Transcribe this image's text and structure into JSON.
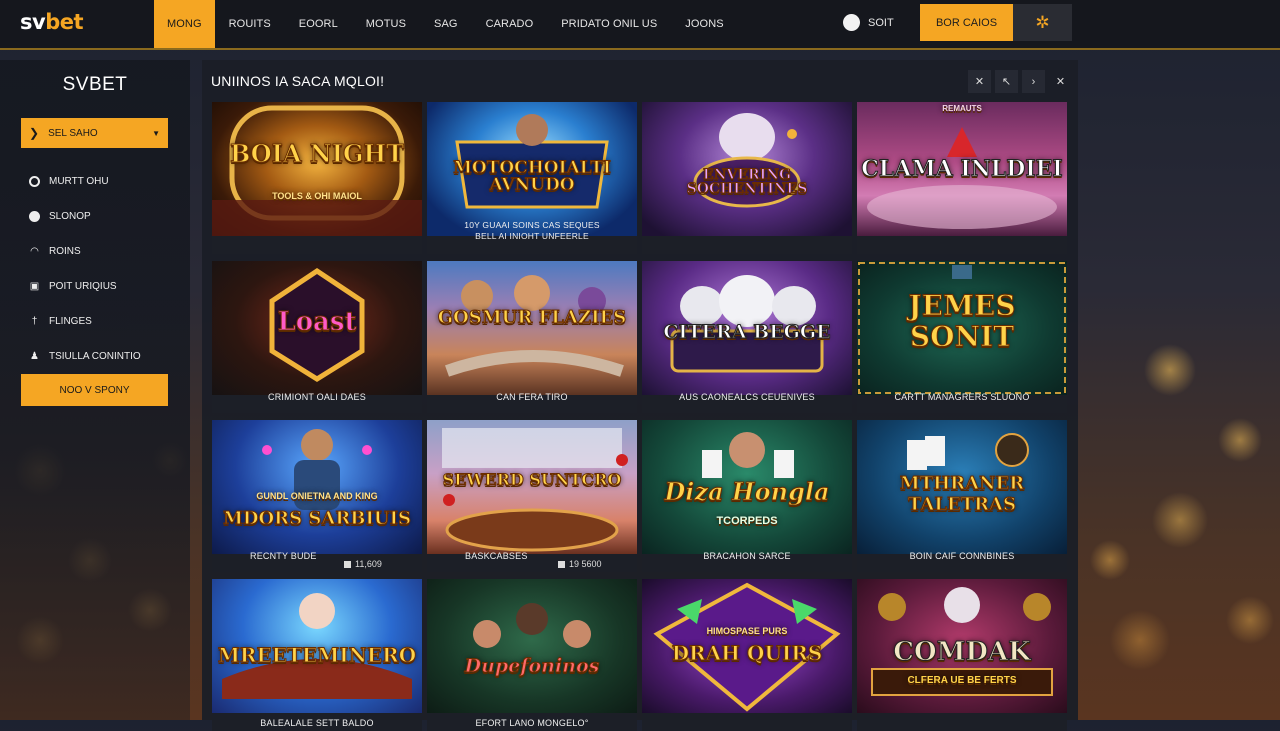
{
  "brand": {
    "logo_part1": "sv",
    "logo_part2": "bet"
  },
  "nav": {
    "items": [
      {
        "label": "MONG",
        "active": true
      },
      {
        "label": "ROUITS"
      },
      {
        "label": "EOORL"
      },
      {
        "label": "MOTUS"
      },
      {
        "label": "SAG"
      },
      {
        "label": "CARADO"
      },
      {
        "label": "PRIDATO ONIL US"
      },
      {
        "label": "JOONS"
      }
    ],
    "sort_label": "SOIT",
    "cta_label": "BOR CAIOS",
    "star_icon": "star-icon"
  },
  "sidebar": {
    "title": "SVBET",
    "select_label": "SEL SAHO",
    "items": [
      {
        "label": "MURTT OHU",
        "icon": "chat-icon"
      },
      {
        "label": "SLONOP",
        "icon": "circle-icon"
      },
      {
        "label": "ROINS",
        "icon": "signal-icon"
      },
      {
        "label": "POIT URIQIUS",
        "icon": "bag-icon"
      },
      {
        "label": "FLINGES",
        "icon": "dagger-icon"
      },
      {
        "label": "TSIULLA CONINTIO",
        "icon": "group-icon"
      }
    ],
    "cta_label": "NOO V SPONY"
  },
  "panel": {
    "title": "UNIINOS IA SACA MQLOI!",
    "controls": [
      "close-icon",
      "edit-icon",
      "next-icon",
      "dismiss-icon"
    ]
  },
  "games": [
    {
      "title": "BOIA NIGHT",
      "subtitle": "TOOLS & OHI MAIOL",
      "caption": "",
      "caption2": ""
    },
    {
      "title": "MOTOCHOIALTI AVNUDO",
      "subtitle": "",
      "caption": "10Y GUAAI SOINS CAS SEQUES",
      "caption2": "BELL AI INIOHT UNFEERLE"
    },
    {
      "title": "ENVERING SOCHENTINES",
      "subtitle": "",
      "caption": "",
      "caption2": ""
    },
    {
      "title": "CLAMA INLDIEI",
      "subtitle": "REMAUTS",
      "caption": "",
      "caption2": ""
    },
    {
      "title": "Loast",
      "subtitle": "",
      "caption": "CRIMIONT OALI DAES",
      "caption2": ""
    },
    {
      "title": "GOSMUR FLAZIES",
      "subtitle": "",
      "caption": "CAN FERA TIRO",
      "caption2": ""
    },
    {
      "title": "CITERA BEGGE",
      "subtitle": "",
      "caption": "AUS CAONEALCS CEUENIVES",
      "caption2": ""
    },
    {
      "title": "JEMES SONIT",
      "subtitle": "",
      "caption": "CARTT MANAGRERS SLUONO",
      "caption2": ""
    },
    {
      "title": "MDORS SARBIUIS",
      "subtitle": "GUNDL ONIETNA AND KING",
      "caption": "RECNTY BUDE",
      "caption2": "",
      "price": "11,609"
    },
    {
      "title": "SEWERD SUNTCRO",
      "subtitle": "",
      "caption": "BASKCABSES",
      "caption2": "",
      "price": "19 5600"
    },
    {
      "title": "Diza Hongla",
      "subtitle": "TCORPEDS",
      "caption": "BRACAHON SARCE",
      "caption2": ""
    },
    {
      "title": "MTHRANER TALETRAS",
      "subtitle": "",
      "caption": "BOIN CAIF CONNBINES",
      "caption2": ""
    },
    {
      "title": "MREETEMINERO",
      "subtitle": "",
      "caption": "BALEALALE SETT BALDO",
      "caption2": ""
    },
    {
      "title": "Dupefoninos",
      "subtitle": "",
      "caption": "EFORT LANO MONGELO°",
      "caption2": ""
    },
    {
      "title": "DRAH QUIRS",
      "subtitle": "HIMOSPASE PURS",
      "caption": "",
      "caption2": ""
    },
    {
      "title": "COMDAK",
      "subtitle": "CLFERA UE BE FERTS",
      "caption": "",
      "caption2": ""
    }
  ],
  "colors": {
    "accent": "#f5a623",
    "bg_dark": "#15171d",
    "panel": "#1b1e26"
  }
}
